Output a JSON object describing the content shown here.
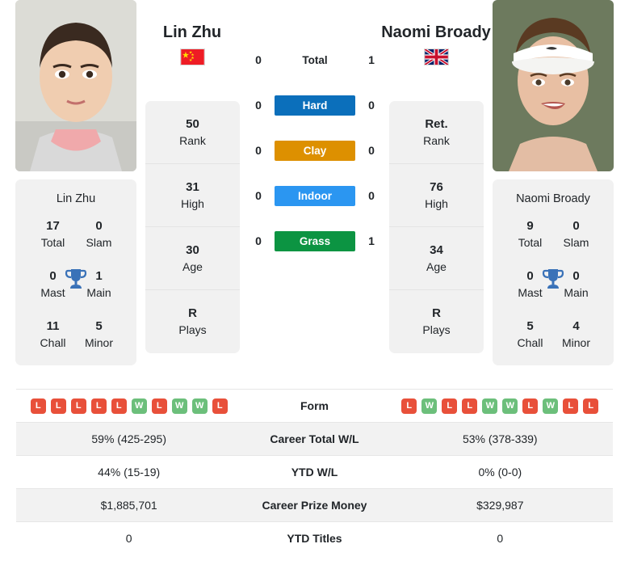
{
  "players": {
    "left": {
      "name": "Lin Zhu",
      "flag": "cn-flag-icon",
      "card_name": "Lin Zhu",
      "titles": [
        {
          "value": "17",
          "label": "Total"
        },
        {
          "value": "0",
          "label": "Slam"
        },
        {
          "value": "0",
          "label": "Mast"
        },
        {
          "value": "1",
          "label": "Main"
        },
        {
          "value": "11",
          "label": "Chall"
        },
        {
          "value": "5",
          "label": "Minor"
        }
      ],
      "stats": [
        {
          "value": "50",
          "label": "Rank"
        },
        {
          "value": "31",
          "label": "High"
        },
        {
          "value": "30",
          "label": "Age"
        },
        {
          "value": "R",
          "label": "Plays"
        }
      ],
      "form": [
        "L",
        "L",
        "L",
        "L",
        "L",
        "W",
        "L",
        "W",
        "W",
        "L"
      ],
      "career_total_wl": "59% (425-295)",
      "ytd_wl": "44% (15-19)",
      "career_prize_money": "$1,885,701",
      "ytd_titles": "0"
    },
    "right": {
      "name": "Naomi Broady",
      "flag": "gb-flag-icon",
      "card_name": "Naomi Broady",
      "titles": [
        {
          "value": "9",
          "label": "Total"
        },
        {
          "value": "0",
          "label": "Slam"
        },
        {
          "value": "0",
          "label": "Mast"
        },
        {
          "value": "0",
          "label": "Main"
        },
        {
          "value": "5",
          "label": "Chall"
        },
        {
          "value": "4",
          "label": "Minor"
        }
      ],
      "stats": [
        {
          "value": "Ret.",
          "label": "Rank"
        },
        {
          "value": "76",
          "label": "High"
        },
        {
          "value": "34",
          "label": "Age"
        },
        {
          "value": "R",
          "label": "Plays"
        }
      ],
      "form": [
        "L",
        "W",
        "L",
        "L",
        "W",
        "W",
        "L",
        "W",
        "L",
        "L"
      ],
      "career_total_wl": "53% (378-339)",
      "ytd_wl": "0% (0-0)",
      "career_prize_money": "$329,987",
      "ytd_titles": "0"
    }
  },
  "head_to_head": [
    {
      "label": "Total",
      "left": "0",
      "right": "1",
      "color": "",
      "plain": true
    },
    {
      "label": "Hard",
      "left": "0",
      "right": "0",
      "color": "#0b6fbb",
      "plain": false
    },
    {
      "label": "Clay",
      "left": "0",
      "right": "0",
      "color": "#dd9000",
      "plain": false
    },
    {
      "label": "Indoor",
      "left": "0",
      "right": "0",
      "color": "#2b96f1",
      "plain": false
    },
    {
      "label": "Grass",
      "left": "0",
      "right": "1",
      "color": "#0c9442",
      "plain": false
    }
  ],
  "table_rows": [
    {
      "label": "Form",
      "left": "",
      "right": "",
      "type": "form"
    },
    {
      "label": "Career Total W/L",
      "left": "59% (425-295)",
      "right": "53% (378-339)",
      "type": "text"
    },
    {
      "label": "YTD W/L",
      "left": "44% (15-19)",
      "right": "0% (0-0)",
      "type": "text"
    },
    {
      "label": "Career Prize Money",
      "left": "$1,885,701",
      "right": "$329,987",
      "type": "text"
    },
    {
      "label": "YTD Titles",
      "left": "0",
      "right": "0",
      "type": "text"
    }
  ],
  "colors": {
    "win": "#6cbf7b",
    "loss": "#e8503a",
    "card_bg": "#f1f1f1",
    "row_shade": "#f2f2f2",
    "trophy": "#3a72b8"
  },
  "icons": {
    "trophy": "trophy-icon",
    "win_badge": "W",
    "loss_badge": "L"
  }
}
